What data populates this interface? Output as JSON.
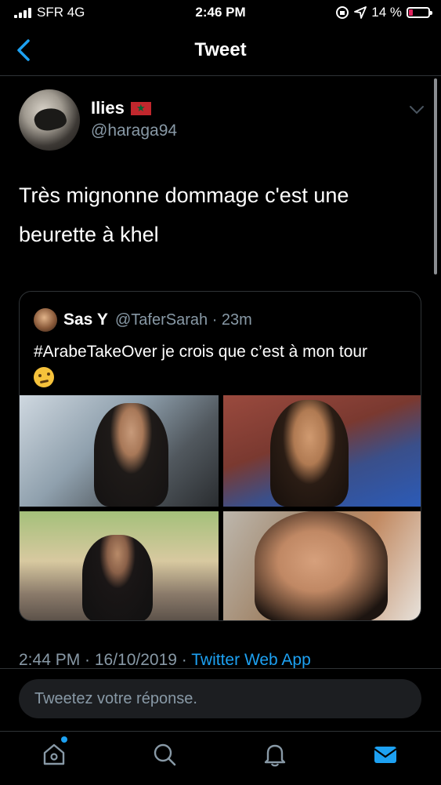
{
  "status_bar": {
    "carrier": "SFR 4G",
    "time": "2:46 PM",
    "battery_percent": "14 %"
  },
  "nav": {
    "title": "Tweet"
  },
  "tweet": {
    "author_name": "Ilies",
    "handle": "@haraga94",
    "text_line1": "Très mignonne dommage c'est une",
    "text_line2": "beurette à khel"
  },
  "quoted_tweet": {
    "name": "Sas Y",
    "handle_time": "@TaferSarah · 23m",
    "text": "#ArabeTakeOver je crois que c’est à mon tour"
  },
  "meta": {
    "timestamp": "2:44 PM · 16/10/2019 · ",
    "source_app": "Twitter Web App"
  },
  "reply": {
    "placeholder": "Tweetez votre réponse."
  },
  "colors": {
    "accent": "#1da1f2",
    "secondary_text": "#8899a6",
    "border": "#2f3336",
    "background": "#000000"
  }
}
